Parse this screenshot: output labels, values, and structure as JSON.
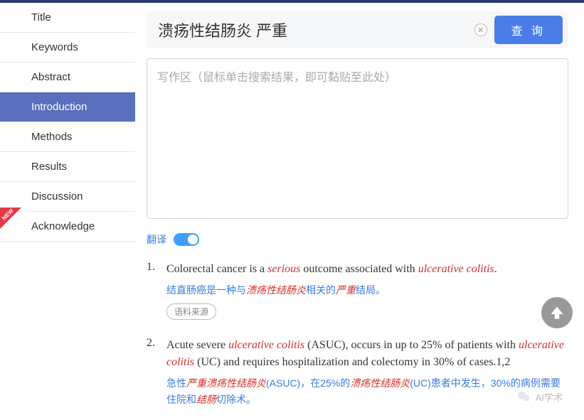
{
  "sidebar": {
    "items": [
      {
        "label": "Title"
      },
      {
        "label": "Keywords"
      },
      {
        "label": "Abstract"
      },
      {
        "label": "Introduction"
      },
      {
        "label": "Methods"
      },
      {
        "label": "Results"
      },
      {
        "label": "Discussion"
      },
      {
        "label": "Acknowledge"
      }
    ],
    "new_badge": "NEW"
  },
  "search": {
    "value": "溃疡性结肠炎 严重",
    "query_button": "查 询"
  },
  "writing_area": {
    "placeholder": "写作区（鼠标单击搜索结果，即可黏贴至此处）"
  },
  "translate": {
    "label": "翻译",
    "on": true
  },
  "results": [
    {
      "num": "1.",
      "en_pre": "Colorectal cancer is a ",
      "en_hl1": "serious",
      "en_mid": " outcome associated with ",
      "en_hl2": "ulcerative colitis",
      "en_post": ".",
      "zh_pre": "结直肠癌是一种与",
      "zh_hl1": "溃疡性结肠炎",
      "zh_mid": "相关的",
      "zh_hl2": "严重",
      "zh_post": "结局。",
      "source_label": "语料来源"
    },
    {
      "num": "2.",
      "en_pre": "Acute severe ",
      "en_hl1": "ulcerative colitis",
      "en_mid1": " (ASUC), occurs in up to 25% of patients with ",
      "en_hl2": "ulcerative colitis",
      "en_post": " (UC) and requires hospitalization and colectomy in 30% of cases.1,2",
      "zh_pre": "急性",
      "zh_hl1": "严重溃疡性结肠炎",
      "zh_mid1": "(ASUC)，在25%的",
      "zh_hl2": "溃疡性结肠炎",
      "zh_mid2": "(UC)患者中发生，30%的病例需要住院和",
      "zh_hl3": "结肠",
      "zh_post": "切除术。"
    }
  ],
  "footer": {
    "tag": "AI学术"
  }
}
